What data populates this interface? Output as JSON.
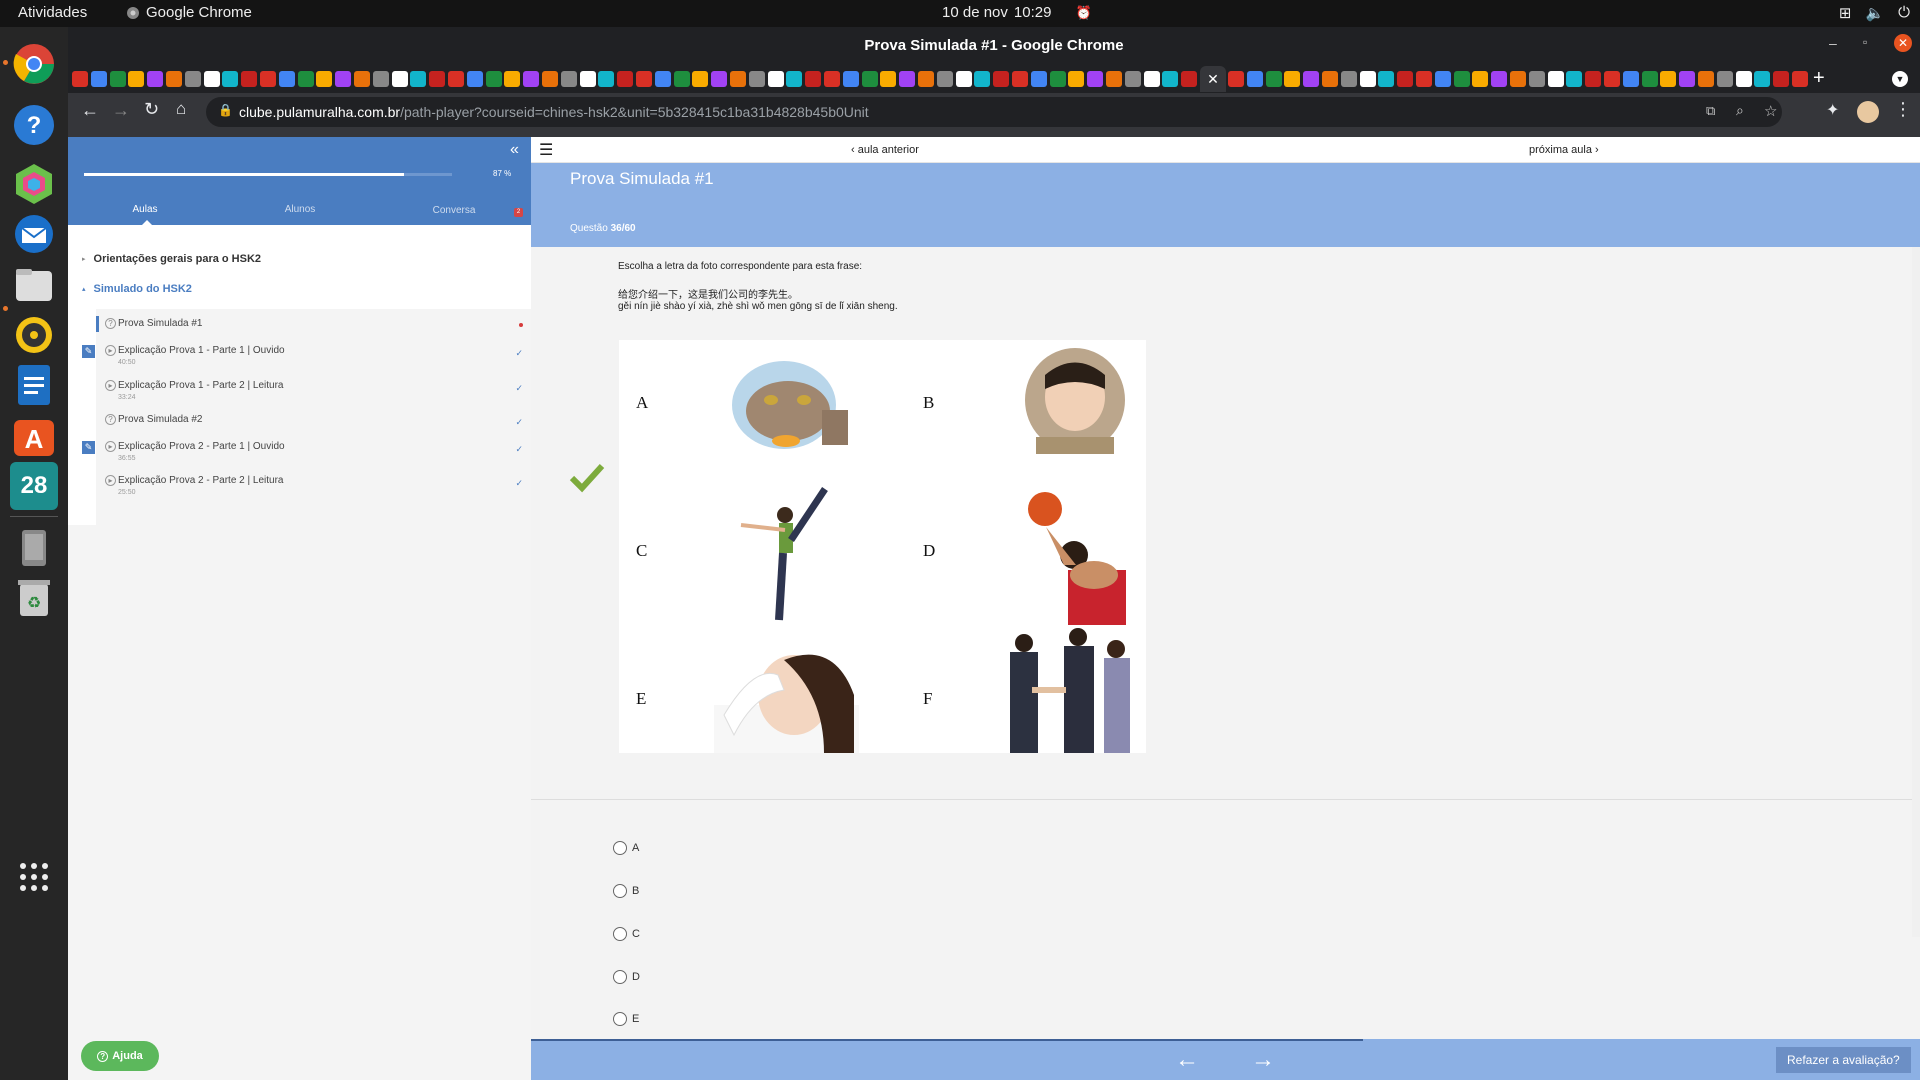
{
  "topbar": {
    "activities": "Atividades",
    "app_name": "Google Chrome",
    "date": "10 de nov",
    "time": "10:29"
  },
  "dock": {
    "calendar_day": "28"
  },
  "browser": {
    "window_title": "Prova Simulada #1 - Google Chrome",
    "url_host": "clube.pulamuralha.com.br",
    "url_path": "/path-player?courseid=chines-hsk2&unit=5b328415c1ba31b4828b45b0Unit"
  },
  "sidebar": {
    "progress_percent": 87,
    "progress_label": "87 %",
    "tabs": [
      "Aulas",
      "Alunos",
      "Conversa"
    ],
    "chat_badge": "2",
    "sections": [
      {
        "title": "Orientações gerais para o HSK2"
      },
      {
        "title": "Simulado do HSK2"
      }
    ],
    "lessons": [
      {
        "label": "Prova Simulada #1",
        "duration": ""
      },
      {
        "label": "Explicação Prova 1 - Parte 1 | Ouvido",
        "duration": "40:50"
      },
      {
        "label": "Explicação Prova 1 - Parte 2 | Leitura",
        "duration": "33:24"
      },
      {
        "label": "Prova Simulada #2",
        "duration": ""
      },
      {
        "label": "Explicação Prova 2 - Parte 1 | Ouvido",
        "duration": "36:55"
      },
      {
        "label": "Explicação Prova 2 - Parte 2 | Leitura",
        "duration": "25:50"
      }
    ],
    "help_button": "Ajuda"
  },
  "main": {
    "prev_lesson": "aula anterior",
    "next_lesson": "próxima aula",
    "title": "Prova Simulada #1",
    "question_prefix": "Questão",
    "question_number": "36/60",
    "instruction": "Escolha a letra da foto correspondente para esta frase:",
    "sentence_hanzi": "给您介绍一下，这是我们公司的李先生。",
    "sentence_pinyin": "gěi nín jiè shào yí xià, zhè shì wǒ men gōng sī de lǐ xiān sheng.",
    "photo_letters": [
      "A",
      "B",
      "C",
      "D",
      "E",
      "F"
    ],
    "options": [
      "A",
      "B",
      "C",
      "D",
      "E"
    ],
    "redo_button": "Refazer a avaliação?"
  },
  "colors": {
    "sidebar_header": "#4a7dc1",
    "main_header": "#8cb0e4",
    "check_green": "#7dab3c"
  }
}
